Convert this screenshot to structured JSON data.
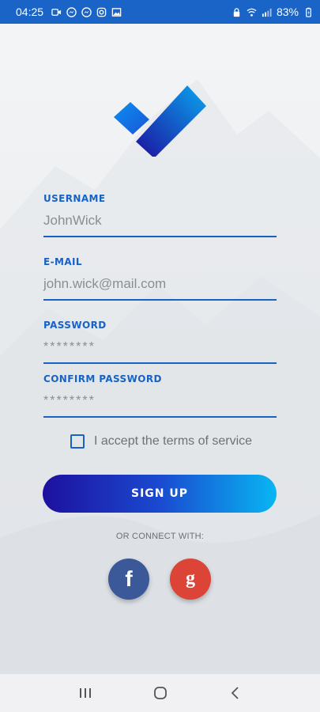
{
  "status_bar": {
    "time": "04:25",
    "battery": "83%",
    "left_icons": [
      "video-icon",
      "messenger-icon",
      "messenger-icon",
      "instagram-icon",
      "gallery-icon"
    ],
    "right_icons": [
      "lock-icon",
      "wifi-icon",
      "signal-icon",
      "battery-icon"
    ],
    "color": "#1a64c8"
  },
  "form": {
    "username": {
      "label": "USERNAME",
      "value": "JohnWick"
    },
    "email": {
      "label": "E-MAIL",
      "value": "john.wick@mail.com"
    },
    "password": {
      "label": "PASSWORD",
      "value": "********"
    },
    "confirm_password": {
      "label": "CONFIRM PASSWORD",
      "value": "********"
    },
    "terms": {
      "label": "I accept the terms of service",
      "checked": false
    },
    "signup_label": "SIGN UP"
  },
  "social": {
    "heading": "OR CONNECT WITH:",
    "facebook_glyph": "f",
    "google_glyph": "g",
    "colors": {
      "facebook": "#3b5998",
      "google": "#db4437"
    }
  },
  "theme": {
    "accent": "#1862c4",
    "button_gradient": [
      "#1d109e",
      "#08b6f2"
    ]
  },
  "nav": {
    "buttons": [
      "recents-icon",
      "home-icon",
      "back-icon"
    ]
  }
}
